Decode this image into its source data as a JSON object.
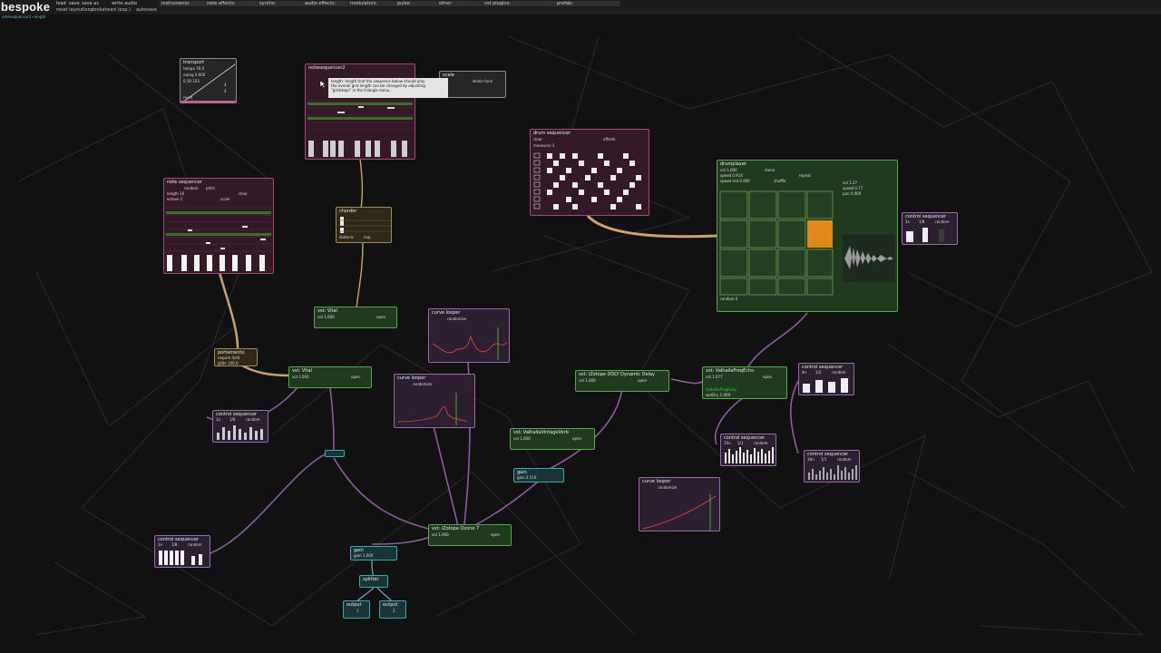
{
  "app": {
    "logo": "bespoke",
    "path": "notesequencer2~length"
  },
  "topbar": {
    "buttons": [
      "load",
      "save",
      "save as",
      "write audio"
    ],
    "buttons2": [
      "reset layout",
      "loop",
      "lookahead (exp.)",
      "autosave"
    ],
    "menus": [
      "instruments:",
      "note effects:",
      "synths:",
      "audio effects:",
      "modulators:",
      "pulse:",
      "other:",
      "vst plugins:",
      "prefab:"
    ]
  },
  "tooltip": {
    "lines": [
      "length: length that the sequence below should play.",
      "the overall grid length can be changed by adjusting",
      "\"gridsteps\" in the triangle menu."
    ]
  },
  "modules": {
    "transport": {
      "title": "transport",
      "tempo": "tempo 76.0",
      "swing": "swing 0.000",
      "pos": "0.58 103",
      "n1": "4",
      "n2": "4",
      "reset": "reset"
    },
    "notesequencer2": {
      "title": "notesequencer2"
    },
    "scale": {
      "title": "scale",
      "opt": "whole tone"
    },
    "drumsequencer": {
      "title": "drum sequencer",
      "clear": "clear",
      "offsets": "offsets",
      "measures": "measures 1"
    },
    "drumplayer": {
      "title": "drumplayer",
      "vol": "vol 1.000",
      "speed": "speed 0.914",
      "speedrnd": "speed rnd 0.000",
      "mono": "mono",
      "shuffle": "shuffle",
      "repeat": "repeat",
      "vol2": "vol 1.27",
      "speed2": "speed 0.77",
      "pan": "pan 0.000",
      "random": "random 0"
    },
    "notesequencer": {
      "title": "note sequencer",
      "mode": "random",
      "pitch": "pitch",
      "len": "length 16",
      "octave": "octave 2",
      "clear": "clear",
      "scale": "scale"
    },
    "chorder": {
      "title": "chorder",
      "mode": "diatonic",
      "scale": "maj"
    },
    "vstvital1": {
      "title": "vst: Vital",
      "vol": "vol 1.000",
      "open": "open"
    },
    "vstvital2": {
      "title": "vst: Vital",
      "vol": "vol 1.000",
      "open": "open"
    },
    "curvelooper1": {
      "title": "curve looper",
      "rand": "randomize"
    },
    "curvelooper2": {
      "title": "curve looper",
      "rand": "randomize"
    },
    "curvelooper3": {
      "title": "curve looper",
      "rand": "randomize"
    },
    "portamento": {
      "title": "portamento",
      "req": "require held",
      "glide": "glide 100.0"
    },
    "dolby": {
      "title": "vst: iZotope DDLY Dynamic Delay",
      "vol": "vol 1.000",
      "open": "open"
    },
    "freqecho": {
      "title": "vst: ValhallaFreqEcho",
      "vol": "vol 1.077",
      "open": "open",
      "name": "ValhallaFreqEcho",
      "dry": "wetDry 1.000"
    },
    "vintage": {
      "title": "vst: ValhallaVintageVerb",
      "vol": "vol 1.000",
      "open": "open"
    },
    "gain1": {
      "title": "gain",
      "val": "gain 3.519"
    },
    "ozone": {
      "title": "vst: iZotope Ozone 7",
      "vol": "vol 1.000",
      "open": "open"
    },
    "gain2": {
      "title": "gain",
      "val": "gain 1.000"
    },
    "splitter": {
      "title": "splitter"
    },
    "out1": {
      "title": "output",
      "ch": "1"
    },
    "out2": {
      "title": "output",
      "ch": "2"
    },
    "cs1": {
      "title": "control sequencer",
      "a": "1n",
      "b": "1/8",
      "r": "random"
    },
    "cs2": {
      "title": "control sequencer",
      "a": "4n",
      "b": "1/2",
      "r": "random"
    },
    "cs3": {
      "title": "control sequencer",
      "a": "16n",
      "b": "1/1",
      "r": "random"
    },
    "cs4": {
      "title": "control sequencer",
      "a": "16n",
      "b": "1/1",
      "r": "random"
    },
    "cs5": {
      "title": "control sequencer",
      "a": "1n",
      "b": "1/8",
      "r": "random"
    },
    "cs6": {
      "title": "control sequencer",
      "a": "1n",
      "b": "1/8",
      "r": "random"
    }
  },
  "colors": {
    "pink": "#a34b78",
    "green": "#56a64c",
    "teal": "#3da7b2",
    "tan": "#a58a52",
    "highlight": "#e08a1c",
    "wire": "#8c5aa0",
    "cable": "#c9a46a"
  }
}
